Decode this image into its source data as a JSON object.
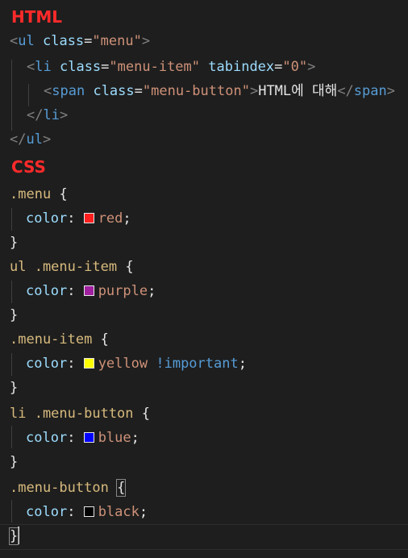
{
  "html_heading": "HTML",
  "css_heading": "CSS",
  "html": {
    "l1": {
      "open": "<",
      "tag": "ul",
      "attr": "class",
      "eq": "=",
      "val": "\"menu\"",
      "close": ">"
    },
    "l2": {
      "open": "<",
      "tag": "li",
      "attr1": "class",
      "eq1": "=",
      "val1": "\"menu-item\"",
      "attr2": "tabindex",
      "eq2": "=",
      "val2": "\"0\"",
      "close": ">"
    },
    "l3": {
      "open": "<",
      "tag": "span",
      "attr": "class",
      "eq": "=",
      "val": "\"menu-button\"",
      "close": ">",
      "text": "HTML에 대해",
      "end_open": "</",
      "end_tag": "span",
      "end_close": ">"
    },
    "l4": {
      "open": "</",
      "tag": "li",
      "close": ">"
    },
    "l5": {
      "open": "</",
      "tag": "ul",
      "close": ">"
    }
  },
  "css": [
    {
      "selector": ".menu",
      "property": "color",
      "value": "red",
      "swatch": "#ff1f1f",
      "important": ""
    },
    {
      "selector": "ul .menu-item",
      "property": "color",
      "value": "purple",
      "swatch": "#a020a0",
      "important": ""
    },
    {
      "selector": ".menu-item",
      "property": "color",
      "value": "yellow",
      "swatch": "#ffff00",
      "important": "!important"
    },
    {
      "selector": "li .menu-button",
      "property": "color",
      "value": "blue",
      "swatch": "#0000ff",
      "important": ""
    },
    {
      "selector": ".menu-button",
      "property": "color",
      "value": "black",
      "swatch": "#000000",
      "important": ""
    }
  ],
  "tokens": {
    "open_brace": "{",
    "close_brace": "}",
    "colon": ":",
    "semicolon": ";"
  }
}
